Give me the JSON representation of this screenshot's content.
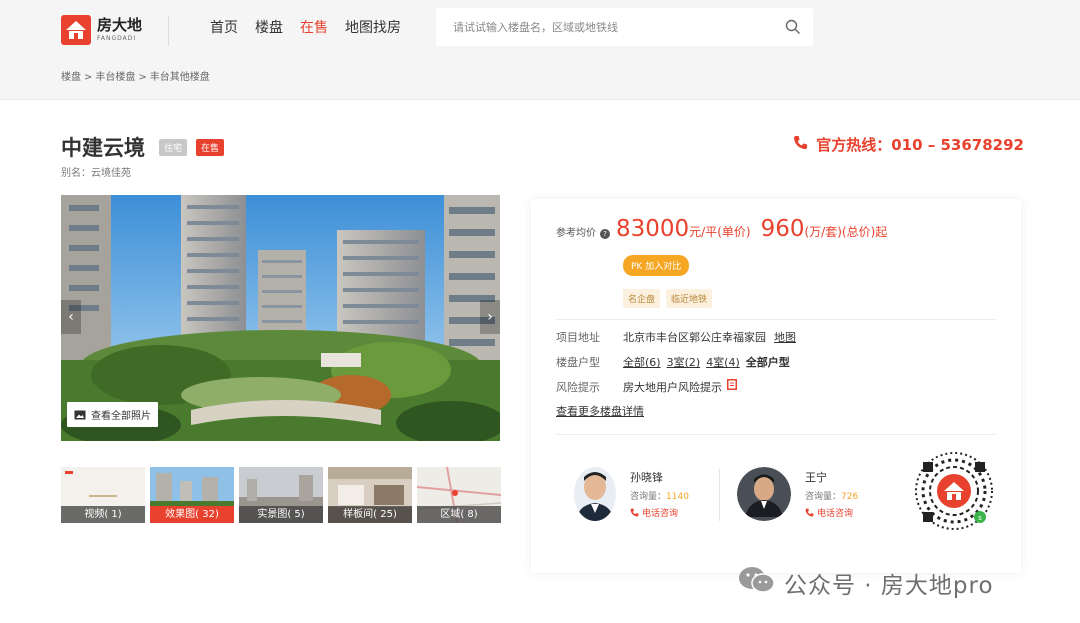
{
  "header": {
    "logo_cn": "房大地",
    "logo_en": "FANGDADI",
    "nav": [
      {
        "label": "首页",
        "active": false
      },
      {
        "label": "楼盘",
        "active": false
      },
      {
        "label": "在售",
        "active": true
      },
      {
        "label": "地图找房",
        "active": false
      }
    ],
    "search_placeholder": "请试试输入楼盘名，区域或地铁线",
    "breadcrumb": [
      "楼盘",
      "丰台楼盘",
      "丰台其他楼盘"
    ],
    "breadcrumb_sep": ">"
  },
  "project": {
    "name": "中建云境",
    "type_tag": "住宅",
    "status_tag": "在售",
    "alias": "别名：云境佳苑",
    "hotline_label": "官方热线：",
    "hotline_number": "010 – 53678292"
  },
  "gallery": {
    "view_all_label": "查看全部照片",
    "thumbs": [
      {
        "label": "视频( 1)",
        "active": false
      },
      {
        "label": "效果图( 32)",
        "active": true
      },
      {
        "label": "实景图( 5)",
        "active": false
      },
      {
        "label": "样板间( 25)",
        "active": false
      },
      {
        "label": "区域( 8)",
        "active": false
      }
    ]
  },
  "card": {
    "price_label": "参考均价",
    "help_glyph": "?",
    "unit_price": "83000",
    "unit_price_suffix": "元/平(单价)",
    "total_price": "960",
    "total_price_suffix": "(万/套)(总价)起",
    "pk_label": "PK 加入对比",
    "features": [
      "名企盘",
      "临近地铁"
    ],
    "address_label": "项目地址",
    "address_value": "北京市丰台区郭公庄幸福家园",
    "map_link": "地图",
    "layout_label": "楼盘户型",
    "layouts": [
      "全部(6)",
      "3室(2)",
      "4室(4)"
    ],
    "layouts_all": "全部户型",
    "risk_label": "风险提示",
    "risk_value": "房大地用户风险提示",
    "more_link": "查看更多楼盘详情",
    "agents": [
      {
        "name": "孙晓锋",
        "count_label": "咨询量：",
        "count": "1140",
        "call_label": "电话咨询"
      },
      {
        "name": "王宁",
        "count_label": "咨询量：",
        "count": "726",
        "call_label": "电话咨询"
      }
    ]
  },
  "watermark": "公众号 · 房大地pro",
  "colors": {
    "brand_red": "#e8422e",
    "accent_orange": "#f5a623"
  }
}
